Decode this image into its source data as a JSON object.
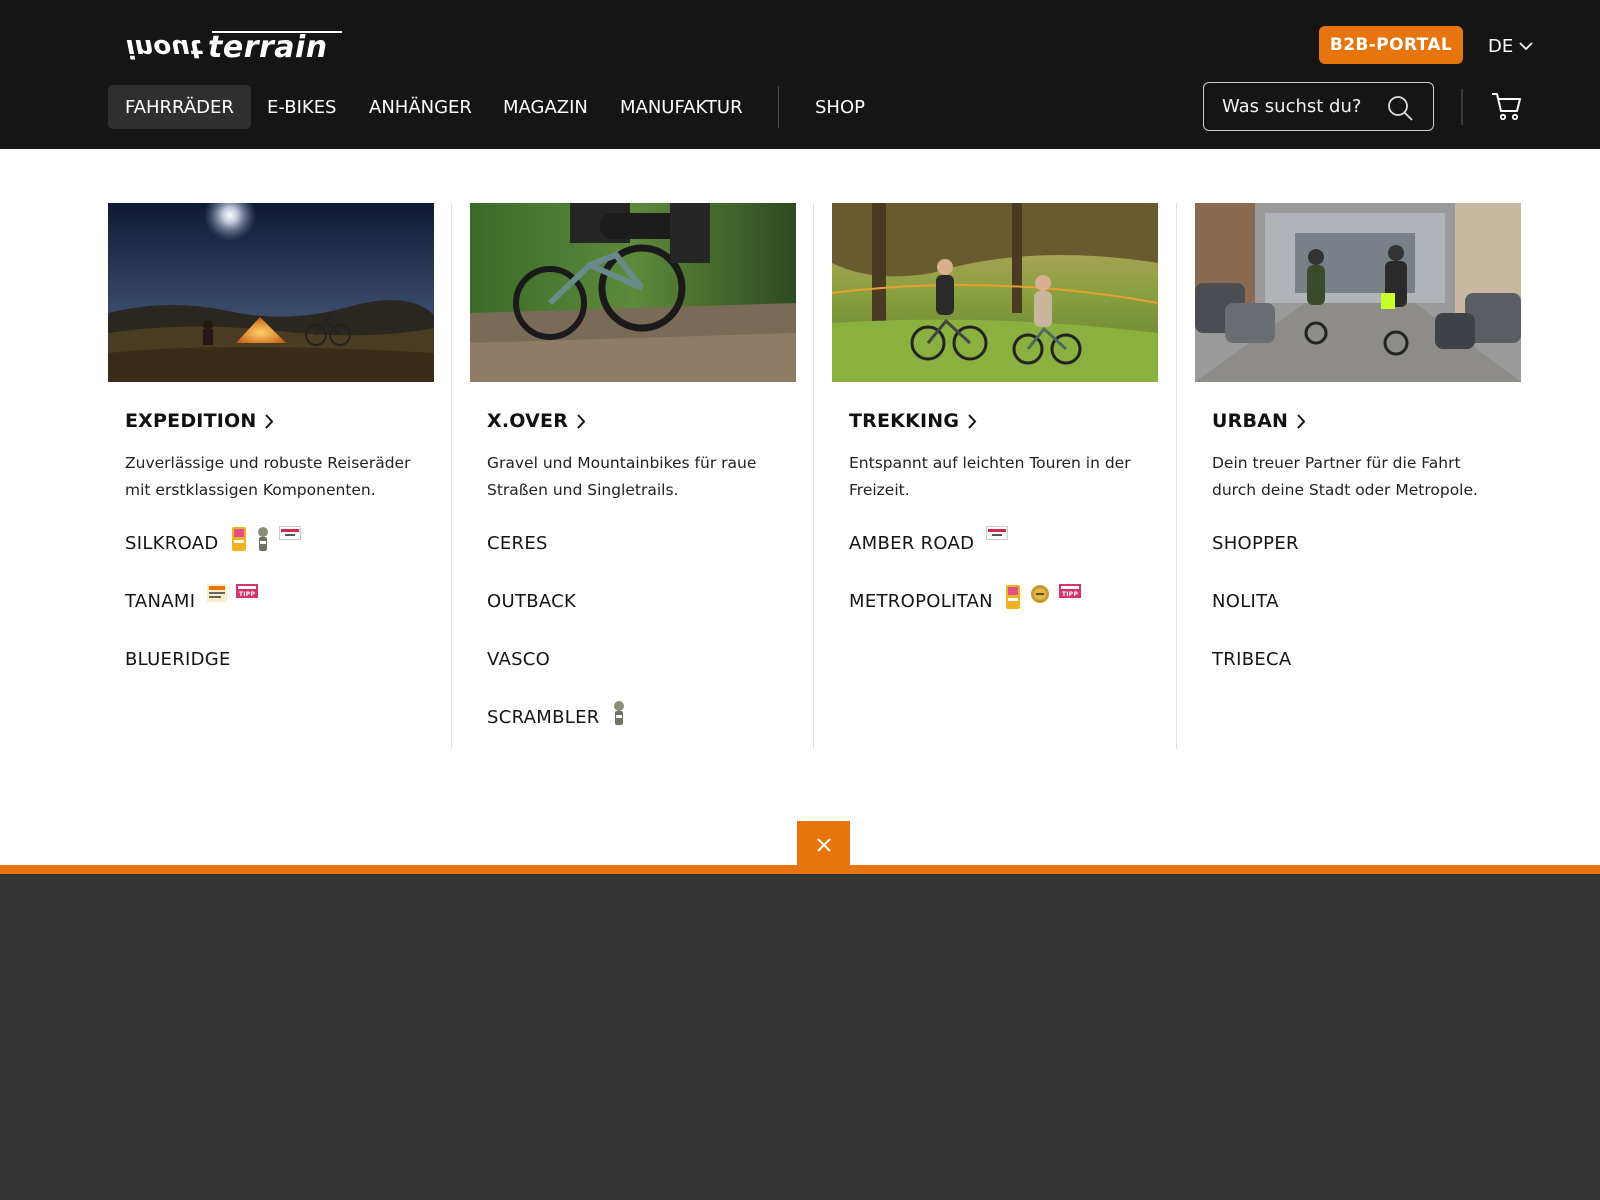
{
  "header": {
    "logo_text": "inoutterrain",
    "b2b_label": "B2B-PORTAL",
    "language": "DE",
    "search_placeholder": "Was suchst du?"
  },
  "nav": {
    "items": [
      {
        "label": "FAHRRÄDER",
        "active": true
      },
      {
        "label": "E-BIKES",
        "active": false
      },
      {
        "label": "ANHÄNGER",
        "active": false
      },
      {
        "label": "MAGAZIN",
        "active": false
      },
      {
        "label": "MANUFAKTUR",
        "active": false
      },
      {
        "label": "SHOP",
        "active": false
      }
    ]
  },
  "categories": [
    {
      "title": "EXPEDITION",
      "description": "Zuverlässige und robuste Reiseräder mit erstklassigen Komponenten.",
      "models": [
        "SILKROAD",
        "TANAMI",
        "BLUERIDGE"
      ]
    },
    {
      "title": "X.OVER",
      "description": "Gravel und Mountainbikes für raue Straßen und Singletrails.",
      "models": [
        "CERES",
        "OUTBACK",
        "VASCO",
        "SCRAMBLER"
      ]
    },
    {
      "title": "TREKKING",
      "description": "Entspannt auf leichten Touren in der Freizeit.",
      "models": [
        "AMBER ROAD",
        "METROPOLITAN"
      ]
    },
    {
      "title": "URBAN",
      "description": "Dein treuer Partner für die Fahrt durch deine Stadt oder Metropole.",
      "models": [
        "SHOPPER",
        "NOLITA",
        "TRIBECA"
      ]
    }
  ],
  "colors": {
    "accent": "#e8740e",
    "header_bg": "#151515",
    "footer_bg": "#333333"
  }
}
